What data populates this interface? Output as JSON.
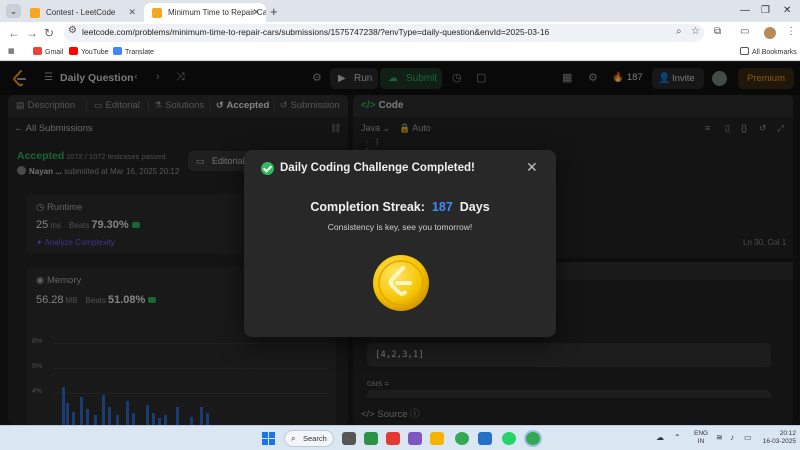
{
  "browser": {
    "tabs": [
      {
        "title": "Contest - LeetCode"
      },
      {
        "title": "Minimum Time to Repair Cars"
      }
    ],
    "url": "leetcode.com/problems/minimum-time-to-repair-cars/submissions/1575747238/?envType=daily-question&envId=2025-03-16",
    "bookmarks": [
      "Gmail",
      "YouTube",
      "Translate"
    ],
    "all_bookmarks": "All Bookmarks"
  },
  "topbar": {
    "title": "Daily Question",
    "run": "Run",
    "submit": "Submit",
    "streak_count": "187",
    "invite": "Invite",
    "premium": "Premium"
  },
  "left": {
    "tabs": [
      "Description",
      "Editorial",
      "Solutions",
      "Accepted",
      "Submission"
    ],
    "all_submissions": "All Submissions",
    "status": "Accepted",
    "testcases": "1072 / 1072 testcases passed",
    "username": "Nayan ...",
    "submitted_at": "submitted at Mar 16, 2025 20:12",
    "editorial_button": "Editorial",
    "runtime": {
      "title": "Runtime",
      "value": "25",
      "unit": "ms",
      "beats_label": "Beats",
      "beats": "79.30%",
      "analyze": "Analyze Complexity"
    },
    "memory": {
      "title": "Memory",
      "value": "56.28",
      "unit": "MB",
      "beats_label": "Beats",
      "beats": "51.08%"
    },
    "chart_axis": [
      "8%",
      "6%",
      "4%"
    ]
  },
  "right": {
    "code_title": "Code",
    "language": "Java",
    "auto": "Auto",
    "code_lines": [
      "- }",
      "}"
    ],
    "cursor_pos": "Ln 30, Col 1",
    "array_value": "[4,2,3,1]",
    "cars_label": "cars =",
    "source": "Source"
  },
  "modal": {
    "title": "Daily Coding Challenge Completed!",
    "streak_label": "Completion Streak:",
    "streak_value": "187",
    "streak_unit": "Days",
    "message": "Consistency is key, see you tomorrow!"
  },
  "taskbar": {
    "search": "Search",
    "lang_line1": "ENG",
    "lang_line2": "IN",
    "time": "20:12",
    "date": "16-03-2025"
  },
  "colors": {
    "accent_green": "#2cbb5d",
    "streak_blue": "#3d8bff",
    "premium_orange": "#ffa116",
    "chart_bar": "#2f6fd0"
  }
}
